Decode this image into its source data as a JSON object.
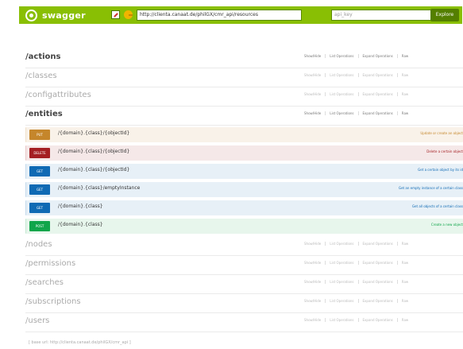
{
  "header": {
    "logo_text": "swagger",
    "logo_icon": "swagger-logo-icon",
    "url_value": "http://clienta.canaat.de/philGX/cmr_api/resources",
    "key_placeholder": "api_key",
    "explore_label": "Explore"
  },
  "resources": [
    {
      "name": "/actions",
      "bold": true,
      "ops": [
        "Show/Hide",
        "List Operations",
        "Expand Operations",
        "Raw"
      ]
    },
    {
      "name": "/classes",
      "bold": false,
      "ops": [
        "Show/Hide",
        "List Operations",
        "Expand Operations",
        "Raw"
      ]
    },
    {
      "name": "/configattributes",
      "bold": false,
      "ops": [
        "Show/Hide",
        "List Operations",
        "Expand Operations",
        "Raw"
      ]
    },
    {
      "name": "/entities",
      "bold": true,
      "ops": [
        "Show/Hide",
        "List Operations",
        "Expand Operations",
        "Raw"
      ]
    },
    {
      "name": "/nodes",
      "bold": false,
      "ops": [
        "Show/Hide",
        "List Operations",
        "Expand Operations",
        "Raw"
      ]
    },
    {
      "name": "/permissions",
      "bold": false,
      "ops": [
        "Show/Hide",
        "List Operations",
        "Expand Operations",
        "Raw"
      ]
    },
    {
      "name": "/searches",
      "bold": false,
      "ops": [
        "Show/Hide",
        "List Operations",
        "Expand Operations",
        "Raw"
      ]
    },
    {
      "name": "/subscriptions",
      "bold": false,
      "ops": [
        "Show/Hide",
        "List Operations",
        "Expand Operations",
        "Raw"
      ]
    },
    {
      "name": "/users",
      "bold": false,
      "ops": [
        "Show/Hide",
        "List Operations",
        "Expand Operations",
        "Raw"
      ]
    }
  ],
  "entities_operations": [
    {
      "method": "PUT",
      "path": "/{domain}.{class}/{objectId}",
      "summary": "Update or create an object",
      "kind": "put"
    },
    {
      "method": "DELETE",
      "path": "/{domain}.{class}/{objectId}",
      "summary": "Delete a certain object",
      "kind": "delete"
    },
    {
      "method": "GET",
      "path": "/{domain}.{class}/{objectId}",
      "summary": "Get a certain object by its id",
      "kind": "get"
    },
    {
      "method": "GET",
      "path": "/{domain}.{class}/emptyInstance",
      "summary": "Get an empty instance of a certain class",
      "kind": "get"
    },
    {
      "method": "GET",
      "path": "/{domain}.{class}",
      "summary": "Get all objects of a certain class",
      "kind": "get"
    },
    {
      "method": "POST",
      "path": "/{domain}.{class}",
      "summary": "Create a new object",
      "kind": "post"
    }
  ],
  "footer_text": "[ base url: http://clienta.canaat.de/philGX/cmr_api ]",
  "colors": {
    "header": "#89bf04",
    "put": "#c5862b",
    "delete": "#a41e22",
    "get": "#0f6ab4",
    "post": "#10a54a"
  }
}
